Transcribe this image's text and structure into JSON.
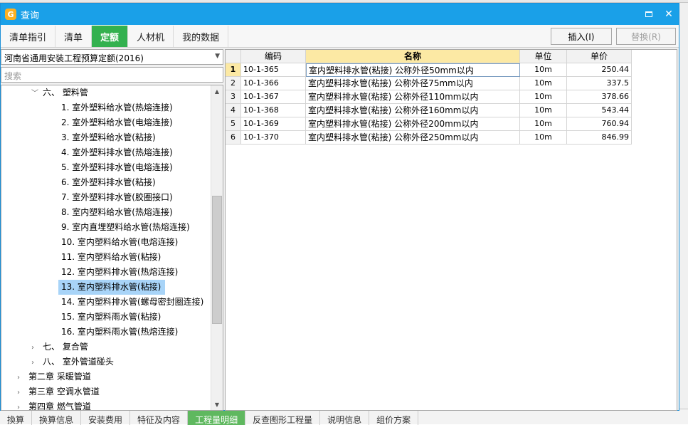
{
  "background": {
    "bottom_tabs": [
      "換算",
      "换算信息",
      "安装费用",
      "特征及内容",
      "工程量明细",
      "反查图形工程量",
      "说明信息",
      "组价方案"
    ],
    "active_bottom_tab": 4
  },
  "window": {
    "title": "查询",
    "icon_glyph": "G"
  },
  "tabs": [
    {
      "label": "清单指引"
    },
    {
      "label": "清单"
    },
    {
      "label": "定额",
      "active": true
    },
    {
      "label": "人材机"
    },
    {
      "label": "我的数据"
    }
  ],
  "toolbar": {
    "insert_label": "插入(I)",
    "replace_label": "替换(R)"
  },
  "library": {
    "selected": "河南省通用安装工程预算定额(2016)"
  },
  "search": {
    "placeholder": "搜索"
  },
  "tree": [
    {
      "label": "六、 塑料管",
      "chev": "﹀",
      "x": 46
    },
    {
      "label": "1. 室外塑料给水管(热熔连接)",
      "x": 84
    },
    {
      "label": "2. 室外塑料给水管(电熔连接)",
      "x": 84
    },
    {
      "label": "3. 室外塑料给水管(粘接)",
      "x": 84
    },
    {
      "label": "4. 室外塑料排水管(热熔连接)",
      "x": 84
    },
    {
      "label": "5. 室外塑料排水管(电熔连接)",
      "x": 84
    },
    {
      "label": "6. 室外塑料排水管(粘接)",
      "x": 84
    },
    {
      "label": "7. 室外塑料排水管(胶圈接口)",
      "x": 84
    },
    {
      "label": "8. 室内塑料给水管(热熔连接)",
      "x": 84
    },
    {
      "label": "9. 室内直埋塑料给水管(热熔连接)",
      "x": 84
    },
    {
      "label": "10. 室内塑料给水管(电熔连接)",
      "x": 84
    },
    {
      "label": "11. 室内塑料给水管(粘接)",
      "x": 84
    },
    {
      "label": "12. 室内塑料排水管(热熔连接)",
      "x": 84
    },
    {
      "label": "13. 室内塑料排水管(粘接)",
      "x": 84,
      "selected": true
    },
    {
      "label": "14. 室内塑料排水管(螺母密封圈连接)",
      "x": 84
    },
    {
      "label": "15. 室内塑料雨水管(粘接)",
      "x": 84
    },
    {
      "label": "16. 室内塑料雨水管(热熔连接)",
      "x": 84
    },
    {
      "label": "七、 复合管",
      "chev": "›",
      "x": 46
    },
    {
      "label": "八、 室外管道碰头",
      "chev": "›",
      "x": 46
    },
    {
      "label": "第二章 采暖管道",
      "chev": "›",
      "x": 26
    },
    {
      "label": "第三章 空调水管道",
      "chev": "›",
      "x": 26
    },
    {
      "label": "第四章 燃气管道",
      "chev": "›",
      "x": 26
    }
  ],
  "table": {
    "headers": {
      "code": "编码",
      "name": "名称",
      "unit": "单位",
      "price": "单价"
    },
    "rows": [
      {
        "n": "1",
        "code": "10-1-365",
        "name": "室内塑料排水管(粘接) 公称外径50mm以内",
        "unit": "10m",
        "price": "250.44"
      },
      {
        "n": "2",
        "code": "10-1-366",
        "name": "室内塑料排水管(粘接) 公称外径75mm以内",
        "unit": "10m",
        "price": "337.5"
      },
      {
        "n": "3",
        "code": "10-1-367",
        "name": "室内塑料排水管(粘接) 公称外径110mm以内",
        "unit": "10m",
        "price": "378.66"
      },
      {
        "n": "4",
        "code": "10-1-368",
        "name": "室内塑料排水管(粘接) 公称外径160mm以内",
        "unit": "10m",
        "price": "543.44"
      },
      {
        "n": "5",
        "code": "10-1-369",
        "name": "室内塑料排水管(粘接) 公称外径200mm以内",
        "unit": "10m",
        "price": "760.94"
      },
      {
        "n": "6",
        "code": "10-1-370",
        "name": "室内塑料排水管(粘接) 公称外径250mm以内",
        "unit": "10m",
        "price": "846.99"
      }
    ]
  }
}
